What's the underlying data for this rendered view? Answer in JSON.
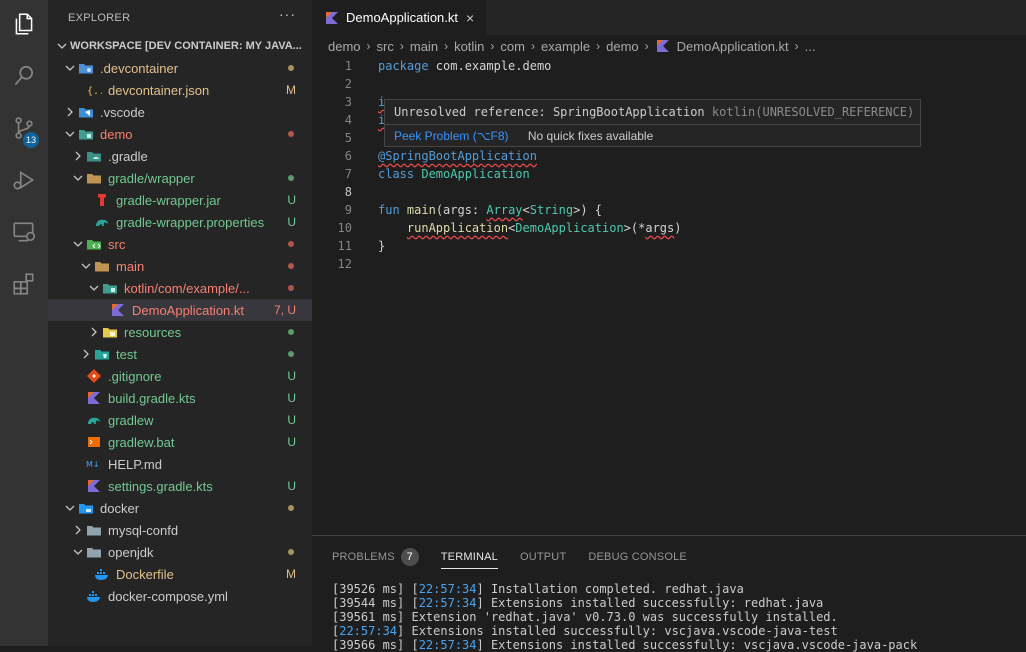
{
  "activity_bar": {
    "scm_badge": "13"
  },
  "explorer": {
    "title": "EXPLORER",
    "more": "···",
    "workspace": "WORKSPACE [DEV CONTAINER: MY JAVA...",
    "items": [
      {
        "label": ".devcontainer",
        "decoration": "",
        "dot": "#a89364"
      },
      {
        "label": "devcontainer.json",
        "decoration": "M",
        "dot": ""
      },
      {
        "label": ".vscode",
        "decoration": "",
        "dot": ""
      },
      {
        "label": "demo",
        "decoration": "",
        "dot": "#b1564b"
      },
      {
        "label": ".gradle",
        "decoration": "",
        "dot": ""
      },
      {
        "label": "gradle/wrapper",
        "decoration": "",
        "dot": "#5b9b6e"
      },
      {
        "label": "gradle-wrapper.jar",
        "decoration": "U",
        "dot": ""
      },
      {
        "label": "gradle-wrapper.properties",
        "decoration": "U",
        "dot": ""
      },
      {
        "label": "src",
        "decoration": "",
        "dot": "#b1564b"
      },
      {
        "label": "main",
        "decoration": "",
        "dot": "#b1564b"
      },
      {
        "label": "kotlin/com/example/...",
        "decoration": "",
        "dot": "#b1564b"
      },
      {
        "label": "DemoApplication.kt",
        "decoration": "7, U",
        "dot": ""
      },
      {
        "label": "resources",
        "decoration": "",
        "dot": "#5b9b6e"
      },
      {
        "label": "test",
        "decoration": "",
        "dot": "#5b9b6e"
      },
      {
        "label": ".gitignore",
        "decoration": "U",
        "dot": ""
      },
      {
        "label": "build.gradle.kts",
        "decoration": "U",
        "dot": ""
      },
      {
        "label": "gradlew",
        "decoration": "U",
        "dot": ""
      },
      {
        "label": "gradlew.bat",
        "decoration": "U",
        "dot": ""
      },
      {
        "label": "HELP.md",
        "decoration": "",
        "dot": ""
      },
      {
        "label": "settings.gradle.kts",
        "decoration": "U",
        "dot": ""
      },
      {
        "label": "docker",
        "decoration": "",
        "dot": "#a89364"
      },
      {
        "label": "mysql-confd",
        "decoration": "",
        "dot": ""
      },
      {
        "label": "openjdk",
        "decoration": "",
        "dot": "#a89364"
      },
      {
        "label": "Dockerfile",
        "decoration": "M",
        "dot": ""
      },
      {
        "label": "docker-compose.yml",
        "decoration": "",
        "dot": ""
      }
    ]
  },
  "editor": {
    "tab_label": "DemoApplication.kt",
    "tab_close": "×",
    "breadcrumbs": [
      "demo",
      "src",
      "main",
      "kotlin",
      "com",
      "example",
      "demo",
      "DemoApplication.kt",
      "..."
    ],
    "line_numbers": [
      "1",
      "2",
      "3",
      "4",
      "5",
      "6",
      "7",
      "8",
      "9",
      "10",
      "11",
      "12"
    ],
    "code": {
      "l1_kw": "package",
      "l1_rest": " com.example.demo",
      "l3_kw": "i",
      "l4_kw": "i",
      "l6": "@SpringBootApplication",
      "l7_kw": "class",
      "l7_name": " DemoApplication",
      "l9_kw": "fun",
      "l9_fn": " main",
      "l9_a": "(args: ",
      "l9_ty1": "Array",
      "l9_b": "<",
      "l9_ty2": "String",
      "l9_c": ">) {",
      "l10_indent": "    ",
      "l10_fn": "runApplication",
      "l10_b": "<",
      "l10_ty": "DemoApplication",
      "l10_c": ">(*",
      "l10_args": "args",
      "l10_d": ")",
      "l11": "}"
    },
    "hover": {
      "message": "Unresolved reference: SpringBootApplication",
      "source": " kotlin(UNRESOLVED_REFERENCE)",
      "peek": "Peek Problem (⌥F8)",
      "no_fixes": "No quick fixes available"
    }
  },
  "panel": {
    "tabs": {
      "problems": "PROBLEMS",
      "problems_count": "7",
      "terminal": "TERMINAL",
      "output": "OUTPUT",
      "debug": "DEBUG CONSOLE"
    },
    "terminal_lines": [
      {
        "prefix": "[39526 ms] [",
        "time": "22:57:34",
        "text": "] Installation completed. redhat.java"
      },
      {
        "prefix": "[39544 ms] [",
        "time": "22:57:34",
        "text": "] Extensions installed successfully: redhat.java"
      },
      {
        "prefix": "[39561 ms] ",
        "time": "",
        "text": "Extension 'redhat.java' v0.73.0 was successfully installed."
      },
      {
        "prefix": "[",
        "time": "22:57:34",
        "text": "] Extensions installed successfully: vscjava.vscode-java-test"
      },
      {
        "prefix": "[39566 ms] [",
        "time": "22:57:34",
        "text": "] Extensions installed successfully: vscjava.vscode-java-pack"
      }
    ]
  },
  "colors": {
    "accent": "#0e639c",
    "modified": "#e2c08d",
    "untracked": "#73c991",
    "error": "#f88070"
  }
}
